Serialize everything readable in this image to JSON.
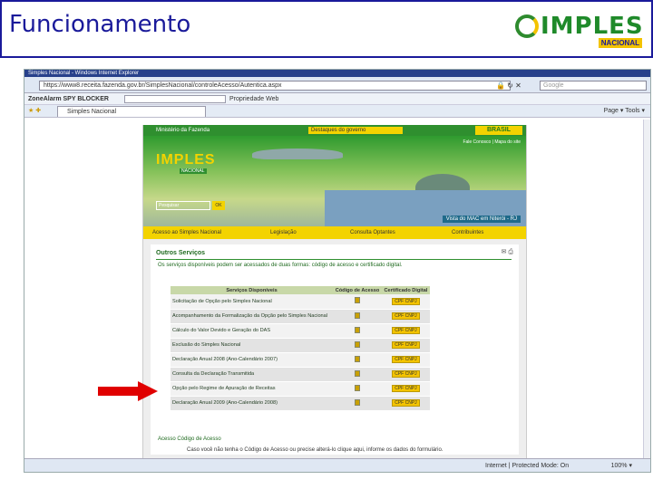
{
  "slide": {
    "title": "Funcionamento",
    "logo_text": "IMPLES",
    "logo_sub": "NACIONAL"
  },
  "browser": {
    "window_title": "Simples Nacional - Windows Internet Explorer",
    "address": "https://www8.receita.fazenda.gov.br/SimplesNacional/controleAcesso/Autentica.aspx",
    "search_placeholder": "Google",
    "zonealarm_label": "ZoneAlarm SPY BLOCKER",
    "zonealarm_prop": "Propriedade Web",
    "tab_label": "Simples Nacional",
    "toolbar_right": "Page ▾  Tools ▾",
    "status_zone": "Internet | Protected Mode: On",
    "zoom": "100% ▾"
  },
  "site": {
    "ministry": "Ministério da Fazenda",
    "dest_select": "Destaques do governo",
    "brasil": "BRASIL",
    "banner_title": "IMPLES",
    "banner_sub": "NACIONAL",
    "caption": "Vista do MAC em Niterói - RJ",
    "links_top": "Fale Conosco | Mapa do site",
    "login_placeholder": "Pesquisar",
    "ok": "OK",
    "menu": [
      "Acesso ao Simples Nacional",
      "Legislação",
      "Consulta Optantes",
      "Contribuintes"
    ],
    "section_title": "Outros Serviços",
    "section_icons": "✉ ⎙",
    "intro": "Os serviços disponíveis podem ser acessados de duas formas: código de acesso e certificado digital.",
    "headers": [
      "Serviços Disponíveis",
      "Código de Acesso",
      "Certificado Digital"
    ],
    "cert_label": "CPF CNPJ",
    "services": [
      "Solicitação de Opção pelo Simples Nacional",
      "Acompanhamento da Formalização da Opção pelo Simples Nacional",
      "Cálculo do Valor Devido e Geração do DAS",
      "Exclusão do Simples Nacional",
      "Declaração Anual 2008 (Ano-Calendário 2007)",
      "Consulta da Declaração Transmitida",
      "Opção pelo Regime de Apuração de Receitas",
      "Declaração Anual 2009 (Ano-Calendário 2008)"
    ],
    "footer_link": "Acesso Código de Acesso",
    "footer_note": "Caso você não tenha o Código de Acesso ou precise alterá-lo clique aqui, informe os dados do formulário."
  }
}
